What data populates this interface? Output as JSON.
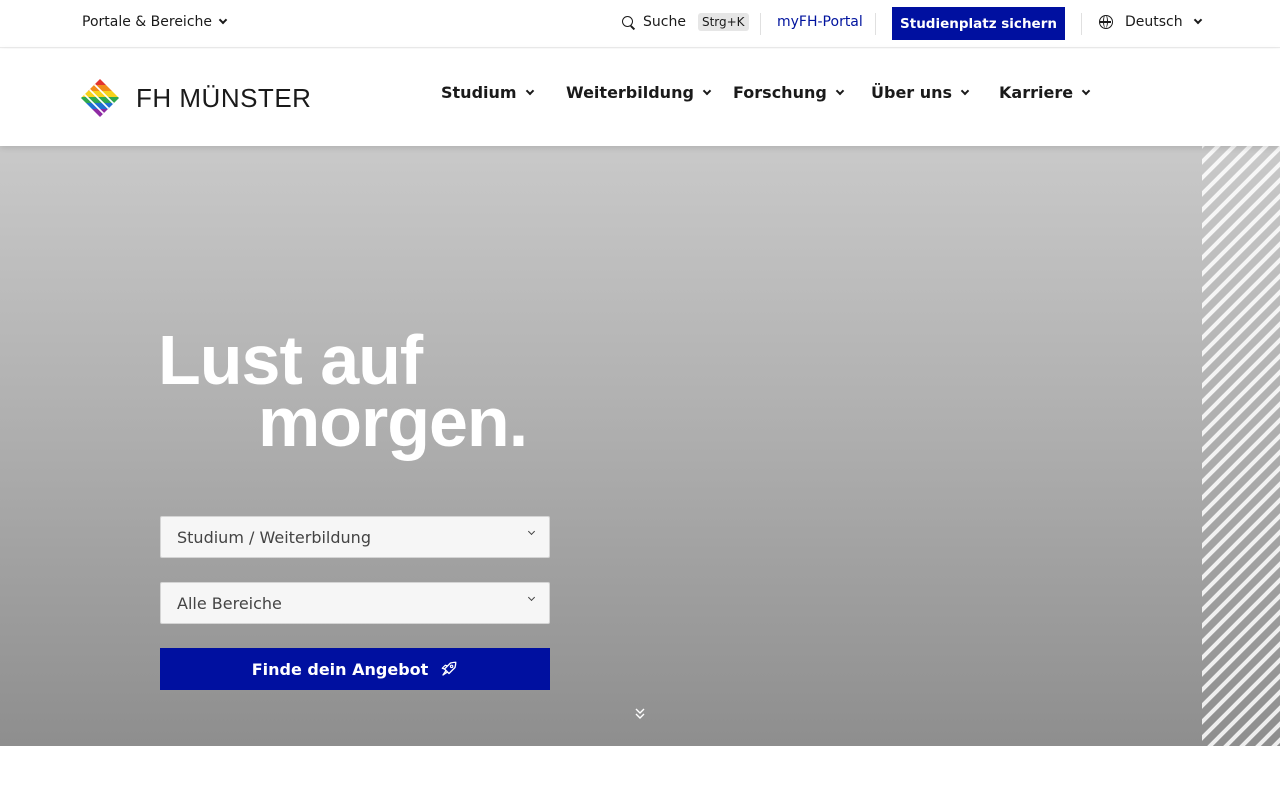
{
  "topbar": {
    "portale_label": "Portale & Bereiche",
    "search_label": "Suche",
    "search_shortcut": "Strg+K",
    "myfh_label": "myFH-Portal",
    "cta_label": "Studienplatz sichern",
    "language_label": "Deutsch"
  },
  "header": {
    "logo_text": "FH MÜNSTER",
    "nav": [
      {
        "label": "Studium"
      },
      {
        "label": "Weiterbildung"
      },
      {
        "label": "Forschung"
      },
      {
        "label": "Über uns"
      },
      {
        "label": "Karriere"
      }
    ]
  },
  "hero": {
    "headline_line1": "Lust auf",
    "headline_line2": "morgen.",
    "select1_value": "Studium / Weiterbildung",
    "select2_value": "Alle Bereiche",
    "find_button_label": "Finde dein Angebot"
  },
  "colors": {
    "brand_blue": "#0010a0",
    "link_blue": "#00139e",
    "hero_gray_top": "#c9c9c9",
    "hero_gray_bottom": "#8e8e8e"
  },
  "icons": {
    "search": "search-icon",
    "globe": "globe-icon",
    "rocket": "rocket-icon",
    "scroll": "double-chevron-down-icon",
    "dropdown": "chevron-down-icon"
  }
}
